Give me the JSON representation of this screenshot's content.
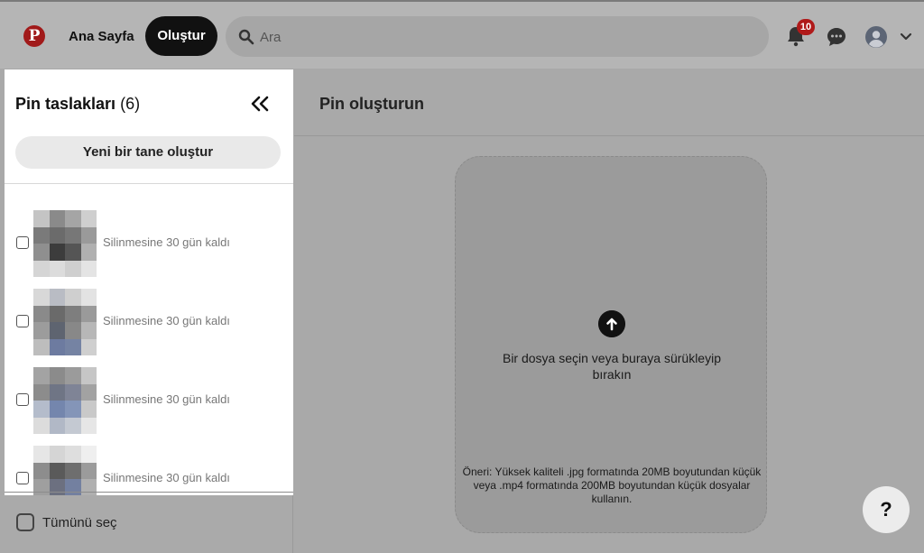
{
  "header": {
    "home_label": "Ana Sayfa",
    "create_label": "Oluştur",
    "notification_count": "10"
  },
  "search": {
    "placeholder": "Ara"
  },
  "sidebar": {
    "title": "Pin taslakları",
    "count": "(6)",
    "new_button": "Yeni bir tane oluştur",
    "drafts": [
      {
        "status": "Silinmesine 30 gün kaldı"
      },
      {
        "status": "Silinmesine 30 gün kaldı"
      },
      {
        "status": "Silinmesine 30 gün kaldı"
      },
      {
        "status": "Silinmesine 30 gün kaldı"
      }
    ],
    "select_all": "Tümünü seç"
  },
  "main": {
    "title": "Pin oluşturun",
    "upload_text": "Bir dosya seçin veya buraya sürükleyip bırakın",
    "upload_tip": "Öneri: Yüksek kaliteli .jpg formatında 20MB boyutundan küçük veya .mp4 formatında 200MB boyutundan küçük dosyalar kullanın."
  },
  "help": {
    "label": "?"
  },
  "colors": {
    "brand": "#a11a1a",
    "dark_button": "#111111"
  },
  "icons": [
    "pinterest-logo-icon",
    "search-icon",
    "bell-icon",
    "chat-icon",
    "avatar-icon",
    "chevron-down-icon",
    "double-chevron-left-icon",
    "upload-arrow-icon"
  ]
}
